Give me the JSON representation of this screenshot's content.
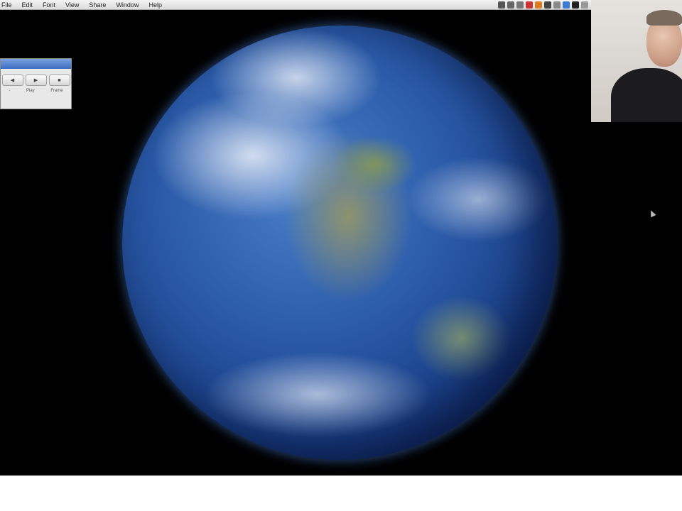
{
  "menubar": {
    "items": [
      "File",
      "Edit",
      "Font",
      "View",
      "Share",
      "Window",
      "Help"
    ],
    "status_icons": [
      "bluetooth-icon",
      "sync-icon",
      "display-icon",
      "battery-icon",
      "notification-icon",
      "camera-icon",
      "wifi-icon",
      "volume-icon",
      "clock-icon",
      "spotlight-icon"
    ]
  },
  "palette": {
    "buttons": [
      {
        "icon": "left-arrow-icon",
        "label": "-"
      },
      {
        "icon": "right-arrow-icon",
        "label": "Play"
      },
      {
        "icon": "camera-icon",
        "label": "Frame"
      }
    ]
  },
  "colors": {
    "desktop": "#000000",
    "menubar": "#e6e6e6",
    "palette_title": "#3a6cc0"
  }
}
